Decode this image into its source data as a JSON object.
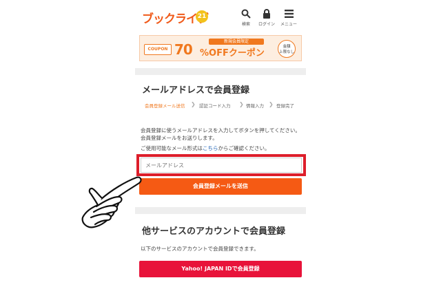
{
  "header": {
    "logo_text": "ブックライブ",
    "logo_badge": "21",
    "nav": [
      {
        "label": "検索",
        "icon": "search-icon"
      },
      {
        "label": "ログイン",
        "icon": "lock-icon"
      },
      {
        "label": "メニュー",
        "icon": "menu-icon"
      }
    ]
  },
  "banner": {
    "coupon_tag": "COUPON",
    "new_member": "新規会員限定",
    "percent": "70",
    "off_text": "%OFFクーポン",
    "limit_line1": "金額",
    "limit_line2": "上限なし"
  },
  "email_section": {
    "title": "メールアドレスで会員登録",
    "steps": [
      "会員登録メール送信",
      "認証コード入力",
      "情報入力",
      "登録完了"
    ],
    "description": "会員登録に使うメールアドレスを入力してボタンを押してください。会員登録メールをお送りします。",
    "format_prefix": "ご使用可能なメール形式は",
    "format_link": "こちら",
    "format_suffix": "からご確認ください。",
    "input_placeholder": "メールアドレス",
    "submit_label": "会員登録メールを送信"
  },
  "other_section": {
    "title": "他サービスのアカウントで会員登録",
    "description": "以下のサービスのアカウントで会員登録できます。",
    "yahoo_label": "Yahoo! JAPAN IDで会員登録"
  },
  "colors": {
    "accent": "#f55a14",
    "highlight": "#dd1e2a",
    "yahoo": "#e8133a"
  }
}
